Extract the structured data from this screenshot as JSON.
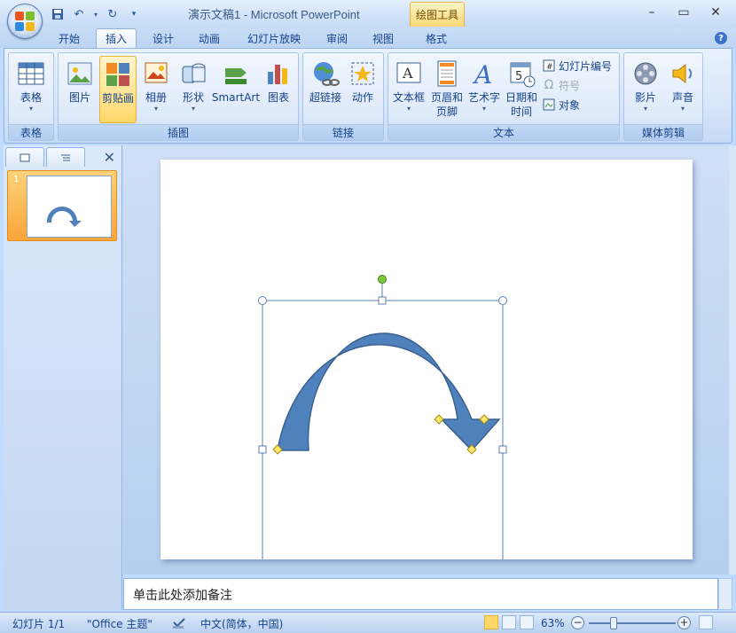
{
  "window": {
    "title": "演示文稿1 - Microsoft PowerPoint",
    "contextual_tab": "绘图工具",
    "min": "–",
    "max": "▭",
    "close": "✕"
  },
  "tabs": [
    "开始",
    "插入",
    "设计",
    "动画",
    "幻灯片放映",
    "审阅",
    "视图",
    "格式"
  ],
  "active_tab": "插入",
  "ribbon": {
    "groups": {
      "table": "表格",
      "illustrations": "插图",
      "links": "链接",
      "text": "文本",
      "media": "媒体剪辑"
    },
    "buttons": {
      "table": "表格",
      "picture": "图片",
      "clipart": "剪贴画",
      "album": "相册",
      "shapes": "形状",
      "smartart": "SmartArt",
      "chart": "图表",
      "hyperlink": "超链接",
      "action": "动作",
      "textbox": "文本框",
      "header_footer_1": "页眉和",
      "header_footer_2": "页脚",
      "wordart": "艺术字",
      "datetime_1": "日期和",
      "datetime_2": "时间",
      "slide_number": "幻灯片编号",
      "symbol": "符号",
      "object": "对象",
      "movie": "影片",
      "sound": "声音"
    },
    "arrow": "▾"
  },
  "slides_panel": {
    "slide_number": "1"
  },
  "notes": {
    "placeholder": "单击此处添加备注"
  },
  "status": {
    "slide": "幻灯片 1/1",
    "theme": "\"Office 主题\"",
    "language": "中文(简体，中国)",
    "zoom": "63%"
  },
  "colors": {
    "shape_fill": "#4f81bd",
    "shape_stroke": "#3a6190",
    "accent": "#ffd86a"
  }
}
